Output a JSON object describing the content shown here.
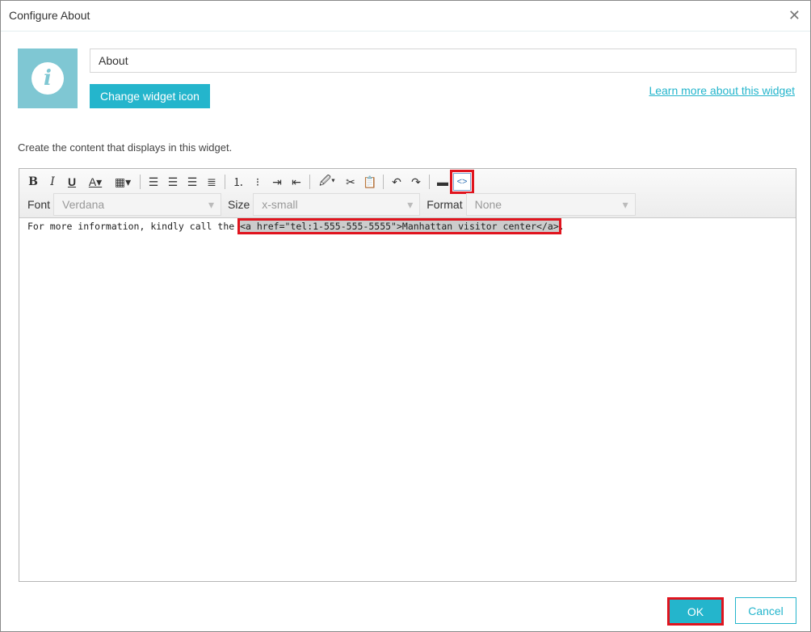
{
  "dialog": {
    "title": "Configure About",
    "close": "✕"
  },
  "widget": {
    "name": "About",
    "change_icon": "Change widget icon",
    "learn_more": "Learn more about this widget",
    "icon": "info-icon",
    "icon_glyph": "i"
  },
  "instructions": "Create the content that displays in this widget.",
  "toolbar": {
    "font_label": "Font",
    "font_value": "Verdana",
    "size_label": "Size",
    "size_value": "x-small",
    "format_label": "Format",
    "format_value": "None"
  },
  "content": {
    "prefix": "For more information, kindly call the ",
    "code": "<a href=\"tel:1-555-555-5555\">Manhattan visitor center</a>",
    "suffix": "."
  },
  "buttons": {
    "ok": "OK",
    "cancel": "Cancel"
  },
  "colors": {
    "accent": "#24b5cc",
    "highlight": "#e0141e"
  }
}
